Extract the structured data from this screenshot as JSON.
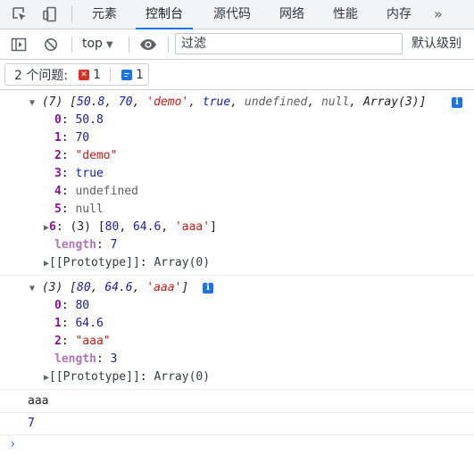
{
  "tabs": {
    "elements": "元素",
    "console": "控制台",
    "sources": "源代码",
    "network": "网络",
    "performance": "性能",
    "memory": "内存",
    "more": "»"
  },
  "toolbar": {
    "context": "top",
    "filter_placeholder": "过滤",
    "levels": "默认级别"
  },
  "issues": {
    "label": "2 个问题:",
    "error_count": "1",
    "info_count": "1"
  },
  "console": {
    "array1": {
      "header_count": "(7)",
      "header_preview_open": "[",
      "header_items": [
        "50.8",
        "70",
        "'demo'",
        "true",
        "undefined",
        "null",
        "Array(3)"
      ],
      "items": [
        {
          "key": "0",
          "value": "50.8"
        },
        {
          "key": "1",
          "value": "70"
        },
        {
          "key": "2",
          "value": "\"demo\""
        },
        {
          "key": "3",
          "value": "true"
        },
        {
          "key": "4",
          "value": "undefined"
        },
        {
          "key": "5",
          "value": "null"
        }
      ],
      "nested_key": "6",
      "nested_count": "(3)",
      "nested_items": [
        "80",
        "64.6",
        "'aaa'"
      ],
      "length_key": "length",
      "length_value": "7",
      "proto_label": "[[Prototype]]",
      "proto_value": "Array(0)"
    },
    "array2": {
      "header_count": "(3)",
      "header_items": [
        "80",
        "64.6",
        "'aaa'"
      ],
      "items": [
        {
          "key": "0",
          "value": "80"
        },
        {
          "key": "1",
          "value": "64.6"
        },
        {
          "key": "2",
          "value": "\"aaa\""
        }
      ],
      "length_key": "length",
      "length_value": "3",
      "proto_label": "[[Prototype]]",
      "proto_value": "Array(0)"
    },
    "log_string": "aaa",
    "log_number": "7",
    "prompt": "›"
  },
  "colors": {
    "accent": "#1a73e8",
    "error": "#d93025",
    "key": "#881391",
    "number": "#1a1aa6",
    "string": "#c41a16"
  }
}
